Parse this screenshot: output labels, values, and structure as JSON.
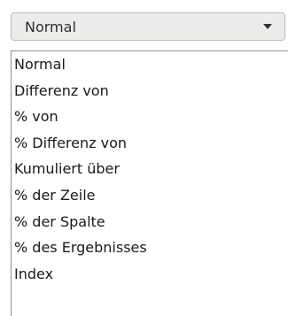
{
  "dropdown": {
    "selected": "Normal",
    "icon": "chevron-down-icon"
  },
  "options": [
    "Normal",
    "Differenz von",
    "% von",
    "% Differenz von",
    "Kumuliert über",
    "% der Zeile",
    "% der Spalte",
    "% des Ergebnisses",
    "Index"
  ]
}
